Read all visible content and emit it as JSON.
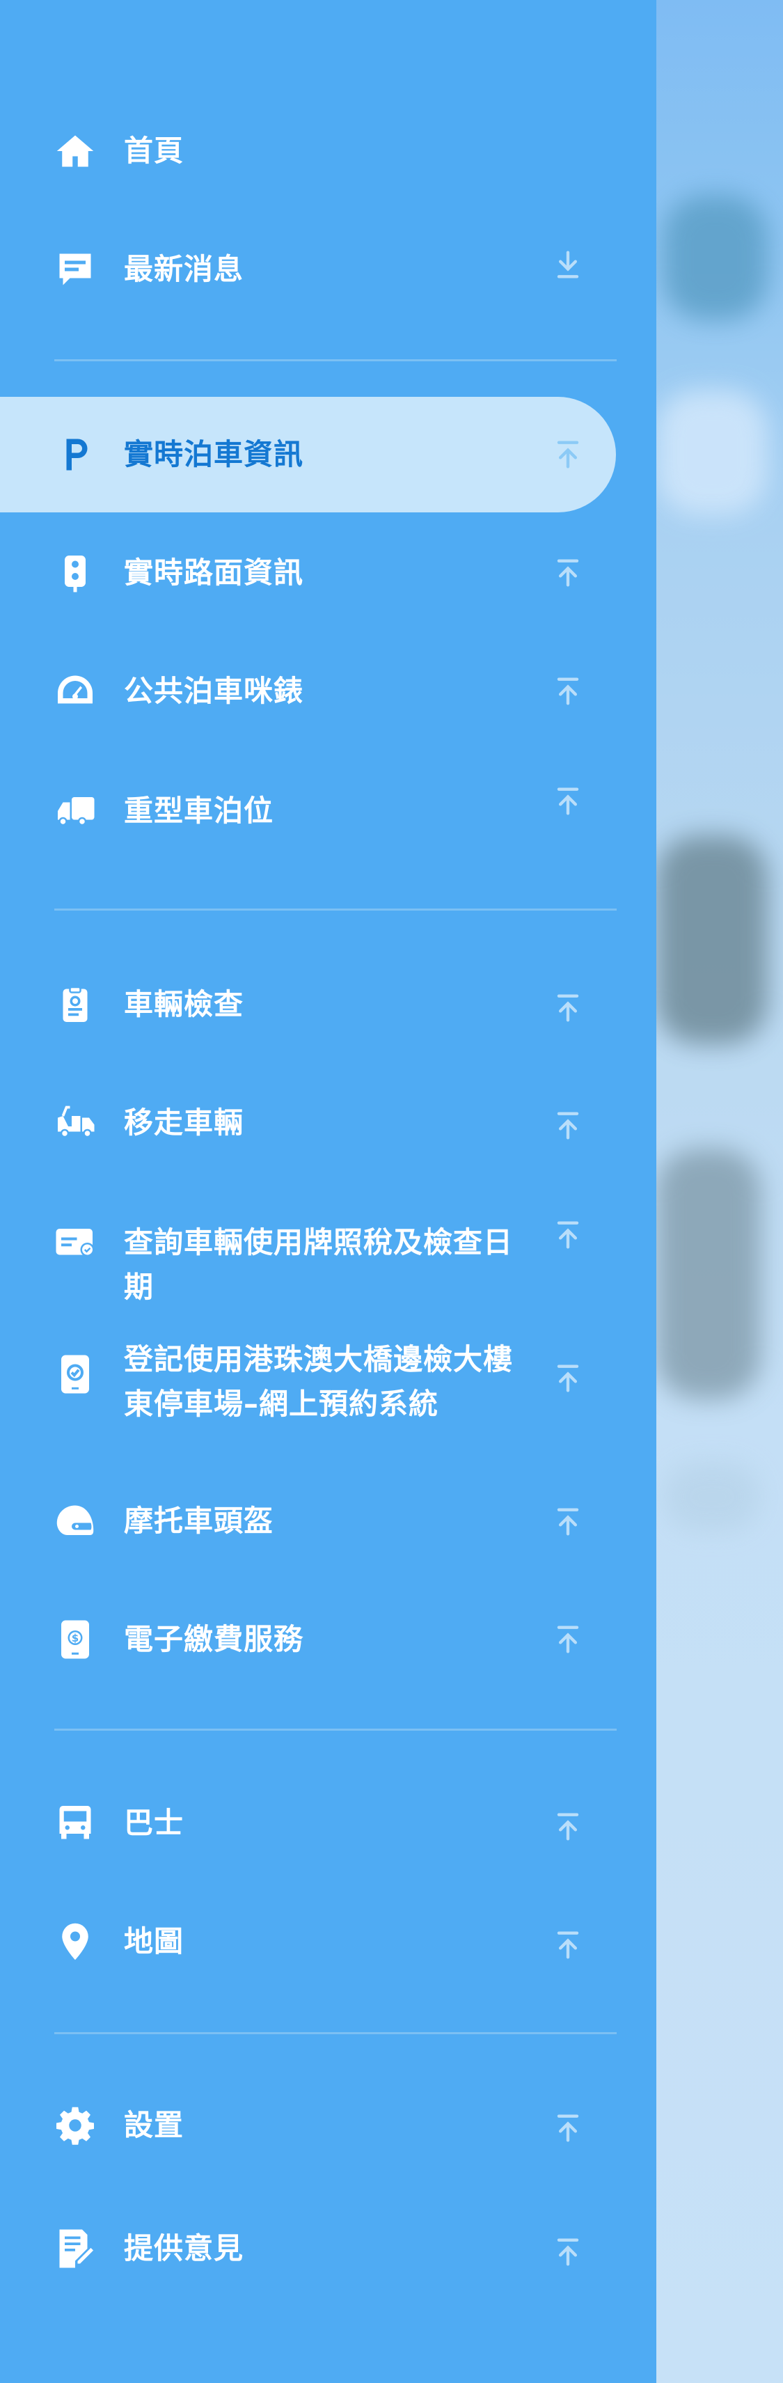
{
  "menu": {
    "items": [
      {
        "key": "home",
        "label": "首頁",
        "icon": "home-icon",
        "arrow": "none"
      },
      {
        "key": "news",
        "label": "最新消息",
        "icon": "message-icon",
        "arrow": "down"
      },
      {
        "key": "realtime-parking",
        "label": "實時泊車資訊",
        "icon": "parking-icon",
        "arrow": "up",
        "active": true
      },
      {
        "key": "realtime-road",
        "label": "實時路面資訊",
        "icon": "traffic-light-icon",
        "arrow": "up"
      },
      {
        "key": "parking-meter",
        "label": "公共泊車咪錶",
        "icon": "meter-icon",
        "arrow": "up"
      },
      {
        "key": "heavy-vehicle",
        "label": "重型車泊位",
        "icon": "truck-icon",
        "arrow": "up"
      },
      {
        "key": "vehicle-inspection",
        "label": "車輛檢查",
        "icon": "clipboard-icon",
        "arrow": "up"
      },
      {
        "key": "towed-vehicle",
        "label": "移走車輛",
        "icon": "tow-truck-icon",
        "arrow": "up"
      },
      {
        "key": "license-tax",
        "label": "查詢車輛使用牌照稅及檢查日期",
        "icon": "card-check-icon",
        "arrow": "up"
      },
      {
        "key": "hzmb-booking",
        "label": "登記使用港珠澳大橋邊檢大樓東停車場–網上預約系統",
        "icon": "phone-check-icon",
        "arrow": "up"
      },
      {
        "key": "helmet",
        "label": "摩托車頭盔",
        "icon": "helmet-icon",
        "arrow": "up"
      },
      {
        "key": "e-payment",
        "label": "電子繳費服務",
        "icon": "phone-payment-icon",
        "arrow": "up"
      },
      {
        "key": "bus",
        "label": "巴士",
        "icon": "bus-icon",
        "arrow": "up"
      },
      {
        "key": "map",
        "label": "地圖",
        "icon": "map-pin-icon",
        "arrow": "up"
      },
      {
        "key": "settings",
        "label": "設置",
        "icon": "gear-icon",
        "arrow": "up"
      },
      {
        "key": "feedback",
        "label": "提供意見",
        "icon": "feedback-icon",
        "arrow": "up"
      }
    ]
  },
  "colors": {
    "drawer_bg": "#4fabf3",
    "active_pill": "#c6e5fb",
    "active_text": "#1478d2",
    "text": "#ffffff",
    "arrow_muted": "#a8d6f8"
  }
}
